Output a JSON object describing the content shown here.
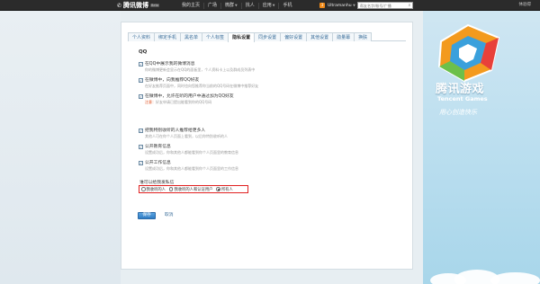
{
  "topbar": {
    "brand": "腾讯微博",
    "beta": "Beta",
    "nav": [
      "我的主页",
      "广场",
      "微群",
      "找人",
      "应用",
      "手机"
    ],
    "notif_count": "3",
    "username": "Ultramanhu",
    "search_placeholder": "帮友名字/帐号/广播",
    "right_text": "休验得"
  },
  "tabs": [
    "个人资料",
    "绑定手机",
    "黑名单",
    "个人标签",
    "隐私设置",
    "同步设置",
    "偏好设置",
    "其他设置",
    "勋量幕",
    "换肤"
  ],
  "active_tab": "隐私设置",
  "qq_section": {
    "title": "QQ",
    "options": [
      {
        "label": "在QQ中展示我的微博消息",
        "desc": "你的微博更新会显示在QQ的面板里，个人资料卡上以及群成员列表中",
        "checked": "✓"
      },
      {
        "label": "在微博中，向我推荐QQ好友",
        "desc": "在好友推荐页面中，同时也向您推荐你当前的QQ号码在微博中推荐好友",
        "checked": "✓"
      },
      {
        "label": "在微博中，允许在听的用户中通过加为QQ好友",
        "warn_label": "注意：",
        "warn": "好友申请已提出能看到你的QQ号码",
        "checked": "✓"
      }
    ]
  },
  "other_options": [
    {
      "label": "把我特别收听的人推荐给更多人",
      "desc": "其他人可在你个人页面上看到，以后你特别收听的人",
      "checked": "✓"
    },
    {
      "label": "公开教育信息",
      "desc": "设置成功后，你和其他人都能看到你个人页面里的教育信息",
      "checked": "✓"
    },
    {
      "label": "公开工作信息",
      "desc": "设置成功后，你和其他人都能看到你个人页面里的工作信息",
      "checked": "✓"
    }
  ],
  "who_can": {
    "title": "谁可以给我发私信",
    "radios": [
      "我收听的人",
      "我收听的人和认证用户",
      "所有人"
    ],
    "selected_index": 2
  },
  "actions": {
    "save": "保存",
    "cancel": "取消"
  },
  "promo": {
    "cn": "腾讯游戏",
    "en": "Tencent Games",
    "slogan": "用心创造快乐"
  },
  "colors": {
    "topbar": "#2b2b2b",
    "accent": "#3a6d99",
    "highlight_border": "#e02020",
    "warning": "#e04b1a"
  }
}
